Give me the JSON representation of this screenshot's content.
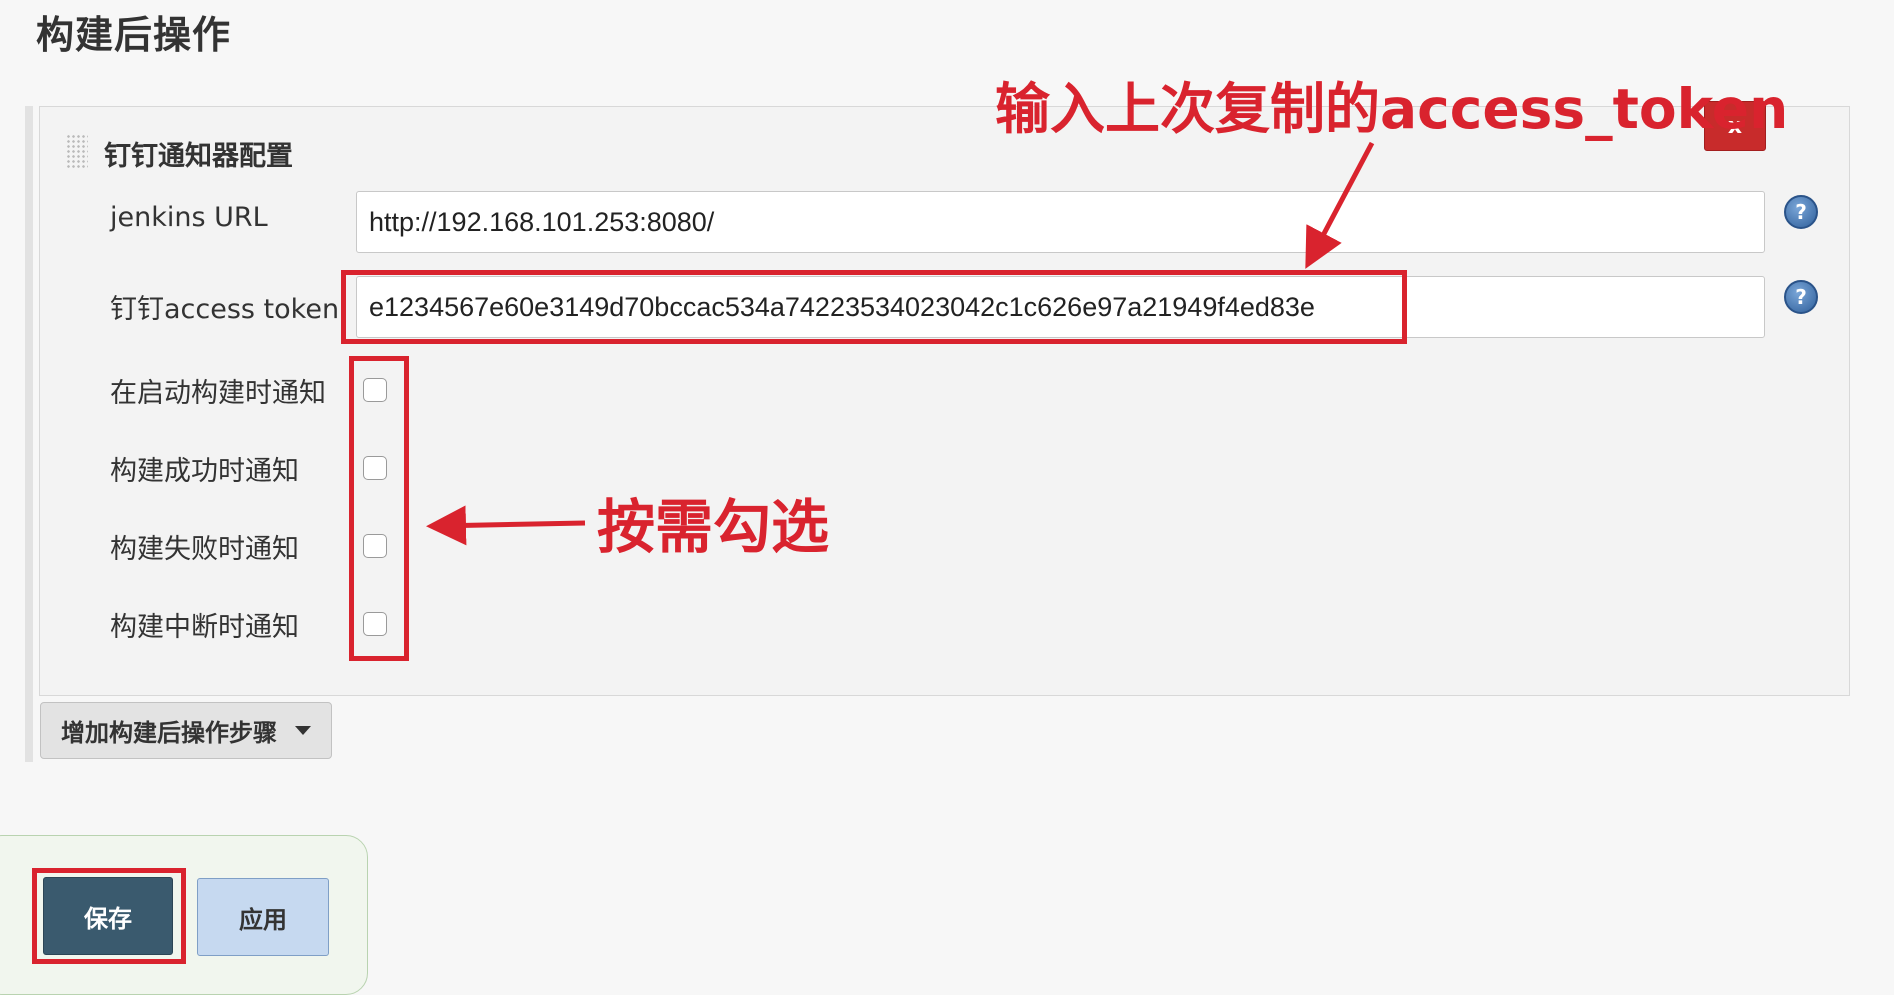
{
  "section_title": "构建后操作",
  "panel": {
    "title": "钉钉通知器配置",
    "close_label": "x"
  },
  "fields": {
    "jenkins_url": {
      "label": "jenkins URL",
      "value": "http://192.168.101.253:8080/"
    },
    "access_token": {
      "label": "钉钉access token",
      "value": "e1234567e60e3149d70bccac534a74223534023042c1c626e97a21949f4ed83e"
    }
  },
  "checkboxes": [
    {
      "label": "在启动构建时通知",
      "checked": false
    },
    {
      "label": "构建成功时通知",
      "checked": false
    },
    {
      "label": "构建失败时通知",
      "checked": false
    },
    {
      "label": "构建中断时通知",
      "checked": false
    }
  ],
  "add_step_label": "增加构建后操作步骤",
  "buttons": {
    "save": "保存",
    "apply": "应用"
  },
  "help_glyph": "?",
  "annotations": {
    "token_hint": "输入上次复制的access_token",
    "checkbox_hint": "按需勾选",
    "color": "#d9232e"
  }
}
